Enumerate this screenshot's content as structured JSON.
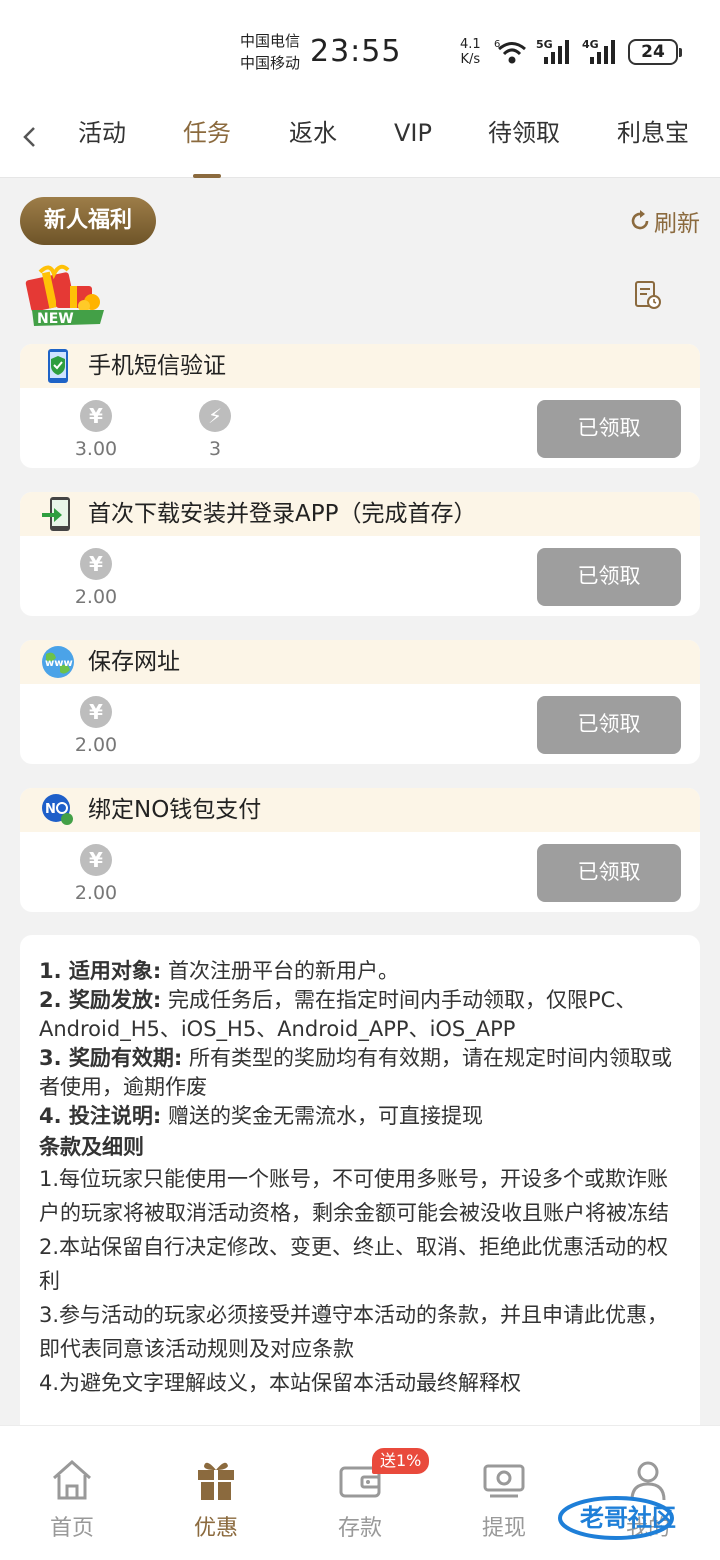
{
  "status_bar": {
    "carrier1": "中国电信",
    "carrier2": "中国移动",
    "time": "23:55",
    "net_speed_value": "4.1",
    "net_speed_unit": "K/s",
    "wifi_label": "6",
    "signal1_label": "5G",
    "signal2_label": "4G",
    "battery": "24"
  },
  "tabs": {
    "items": [
      {
        "label": "活动"
      },
      {
        "label": "任务"
      },
      {
        "label": "返水"
      },
      {
        "label": "VIP"
      },
      {
        "label": "待领取"
      },
      {
        "label": "利息宝"
      }
    ],
    "active_index": 1
  },
  "section": {
    "newbie_label": "新人福利",
    "refresh_label": "刷新",
    "new_badge": "NEW"
  },
  "tasks": [
    {
      "title": "手机短信验证",
      "icon": "phone-shield-icon",
      "reward_amount": "3.00",
      "energy": "3",
      "button": "已领取"
    },
    {
      "title": "首次下载安装并登录APP（完成首存）",
      "icon": "phone-download-icon",
      "reward_amount": "2.00",
      "button": "已领取"
    },
    {
      "title": "保存网址",
      "icon": "globe-www-icon",
      "reward_amount": "2.00",
      "button": "已领取"
    },
    {
      "title": "绑定NO钱包支付",
      "icon": "no-wallet-icon",
      "reward_amount": "2.00",
      "button": "已领取"
    }
  ],
  "rules": {
    "r1_label": "1. 适用对象:",
    "r1_text": " 首次注册平台的新用户。",
    "r2_label": "2. 奖励发放:",
    "r2_text": " 完成任务后，需在指定时间内手动领取，仅限PC、Android_H5、iOS_H5、Android_APP、iOS_APP",
    "r3_label": "3. 奖励有效期:",
    "r3_text": " 所有类型的奖励均有有效期，请在规定时间内领取或者使用，逾期作废",
    "r4_label": "4. 投注说明:",
    "r4_text": " 赠送的奖金无需流水，可直接提现",
    "terms_title": "条款及细则",
    "term1": "1.每位玩家只能使用一个账号，不可使用多账号，开设多个或欺诈账户的玩家将被取消活动资格，剩余金额可能会被没收且账户将被冻结",
    "term2": "2.本站保留自行决定修改、变更、终止、取消、拒绝此优惠活动的权利",
    "term3": "3.参与活动的玩家必须接受并遵守本活动的条款，并且申请此优惠，即代表同意该活动规则及对应条款",
    "term4": "4.为避免文字理解歧义，本站保留本活动最终解释权"
  },
  "bottom_nav": {
    "items": [
      {
        "label": "首页",
        "icon": "home-icon"
      },
      {
        "label": "优惠",
        "icon": "gift-icon"
      },
      {
        "label": "存款",
        "icon": "wallet-icon"
      },
      {
        "label": "提现",
        "icon": "withdraw-icon"
      },
      {
        "label": "我的",
        "icon": "user-icon"
      }
    ],
    "active_index": 1,
    "deposit_badge": "送1%"
  },
  "watermark": {
    "text": "老哥社区"
  },
  "colors": {
    "accent": "#8b6a3e",
    "button_disabled": "#9e9e9e",
    "card_header": "#fcf5e7",
    "badge_red": "#e94a3c"
  }
}
